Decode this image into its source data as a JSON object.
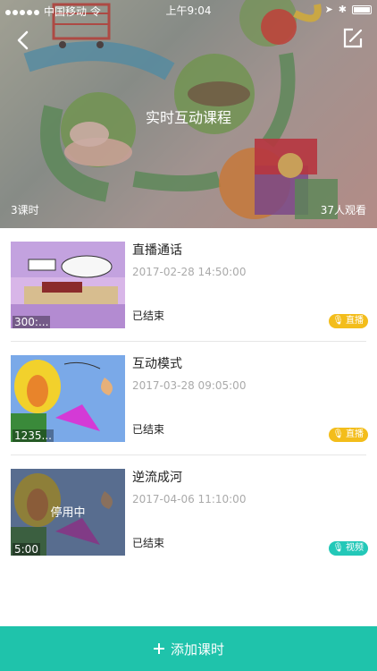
{
  "status_bar": {
    "carrier": "中国移动 令",
    "time": "上午9:04"
  },
  "header": {
    "title": "实时互动课程",
    "lesson_count": "3课时",
    "viewer_count": "37人观看"
  },
  "lessons": [
    {
      "title": "直播通话",
      "date": "2017-02-28 14:50:00",
      "status": "已结束",
      "duration": "300:...",
      "tag": "直播",
      "tag_color": "#f3bd1b"
    },
    {
      "title": "互动模式",
      "date": "2017-03-28 09:05:00",
      "status": "已结束",
      "duration": "1235...",
      "tag": "直播",
      "tag_color": "#f3bd1b"
    },
    {
      "title": "逆流成河",
      "date": "2017-04-06 11:10:00",
      "status": "已结束",
      "duration": "5:00",
      "tag": "视频",
      "tag_color": "#23c8b8",
      "overlay": "停用中"
    }
  ],
  "footer": {
    "add_label": "添加课时"
  },
  "colors": {
    "accent": "#1fc3ab",
    "live_tag": "#f3bd1b",
    "video_tag": "#23c8b8"
  }
}
